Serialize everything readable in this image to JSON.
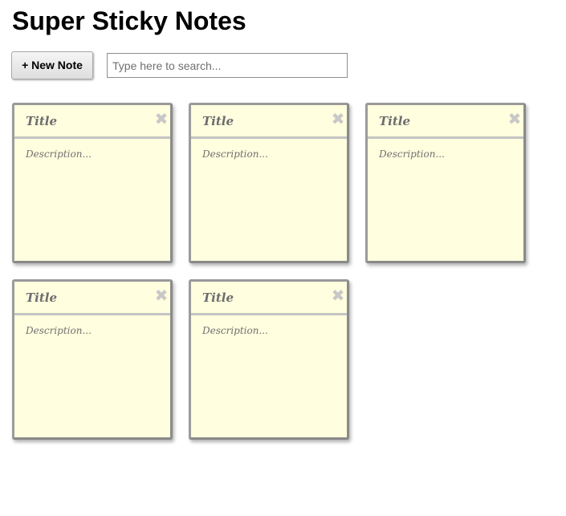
{
  "app": {
    "title": "Super Sticky Notes"
  },
  "toolbar": {
    "new_note_label": "+ New Note",
    "search_placeholder": "Type here to search...",
    "search_value": ""
  },
  "notes": [
    {
      "title_placeholder": "Title",
      "title_value": "",
      "description_placeholder": "Description...",
      "description_value": "",
      "delete_glyph": "✖"
    },
    {
      "title_placeholder": "Title",
      "title_value": "",
      "description_placeholder": "Description...",
      "description_value": "",
      "delete_glyph": "✖"
    },
    {
      "title_placeholder": "Title",
      "title_value": "",
      "description_placeholder": "Description...",
      "description_value": "",
      "delete_glyph": "✖"
    },
    {
      "title_placeholder": "Title",
      "title_value": "",
      "description_placeholder": "Description...",
      "description_value": "",
      "delete_glyph": "✖"
    },
    {
      "title_placeholder": "Title",
      "title_value": "",
      "description_placeholder": "Description...",
      "description_value": "",
      "delete_glyph": "✖"
    }
  ],
  "colors": {
    "note_background": "#fffedf",
    "note_border": "#8a8a8a"
  },
  "icons": {
    "delete": "close-icon"
  }
}
